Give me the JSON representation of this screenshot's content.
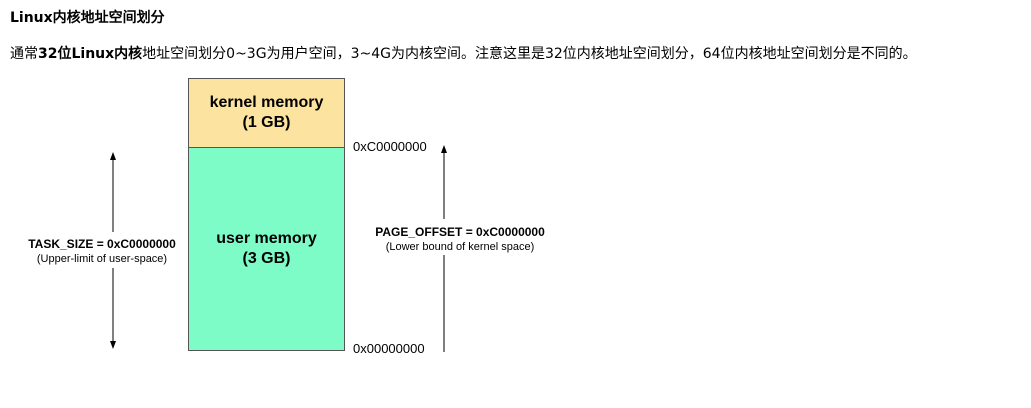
{
  "heading": "Linux内核地址空间划分",
  "intro": {
    "prefix": "通常",
    "bold": "32位Linux内核",
    "rest": "地址空间划分0~3G为用户空间，3~4G为内核空间。注意这里是32位内核地址空间划分，64位内核地址空间划分是不同的。"
  },
  "diagram": {
    "kernel_block": {
      "line1": "kernel memory",
      "line2": "(1 GB)",
      "color": "#fce4a0"
    },
    "user_block": {
      "line1": "user memory",
      "line2": "(3 GB)",
      "color": "#7dfcc8"
    },
    "addr_top": "0xC0000000",
    "addr_bottom": "0x00000000",
    "left_caption": {
      "main": "TASK_SIZE = 0xC0000000",
      "sub": "(Upper-limit of user-space)"
    },
    "right_caption": {
      "main": "PAGE_OFFSET = 0xC0000000",
      "sub": "(Lower bound of kernel space)"
    }
  }
}
